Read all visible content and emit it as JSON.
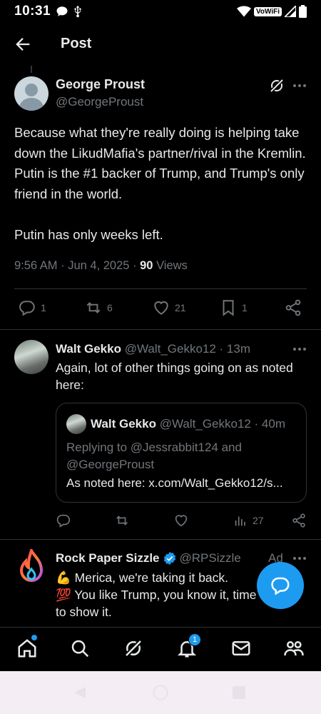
{
  "status_bar": {
    "time": "10:31",
    "vowifi": "VoWiFi"
  },
  "header": {
    "title": "Post"
  },
  "post": {
    "author_name": "George Proust",
    "author_handle": "@GeorgeProust",
    "text": "Because what they're really doing is helping take down the LikudMafia's partner/rival in the Kremlin.  Putin is the #1 backer of Trump, and Trump's only friend in the world.\n\nPutin has only weeks left.",
    "time": "9:56 AM · Jun 4, 2025 ·",
    "views_count": "90",
    "views_label": "Views",
    "replies": "1",
    "reposts": "6",
    "likes": "21",
    "bookmarks": "1"
  },
  "reply": {
    "author_name": "Walt Gekko",
    "author_handle": "@Walt_Gekko12",
    "age": "· 13m",
    "text": "Again, lot of other things going on as noted here:",
    "views": "27",
    "quote": {
      "author_name": "Walt Gekko",
      "author_handle": "@Walt_Gekko12",
      "age": "· 40m",
      "replying_to": "Replying to @Jessrabbit124 and @GeorgeProust",
      "text": "As noted here: x.com/Walt_Gekko12/s..."
    }
  },
  "ad": {
    "author_name": "Rock Paper Sizzle",
    "author_handle": "@RPSizzle",
    "label": "Ad",
    "line1": "💪 Merica, we're taking it back.",
    "line2": "💯 You like Trump, you know it, time to show it."
  },
  "nav": {
    "notifications_badge": "1"
  },
  "colors": {
    "accent": "#1d9bf0",
    "muted": "#71767b",
    "text": "#e7e9ea",
    "background": "#000000"
  }
}
